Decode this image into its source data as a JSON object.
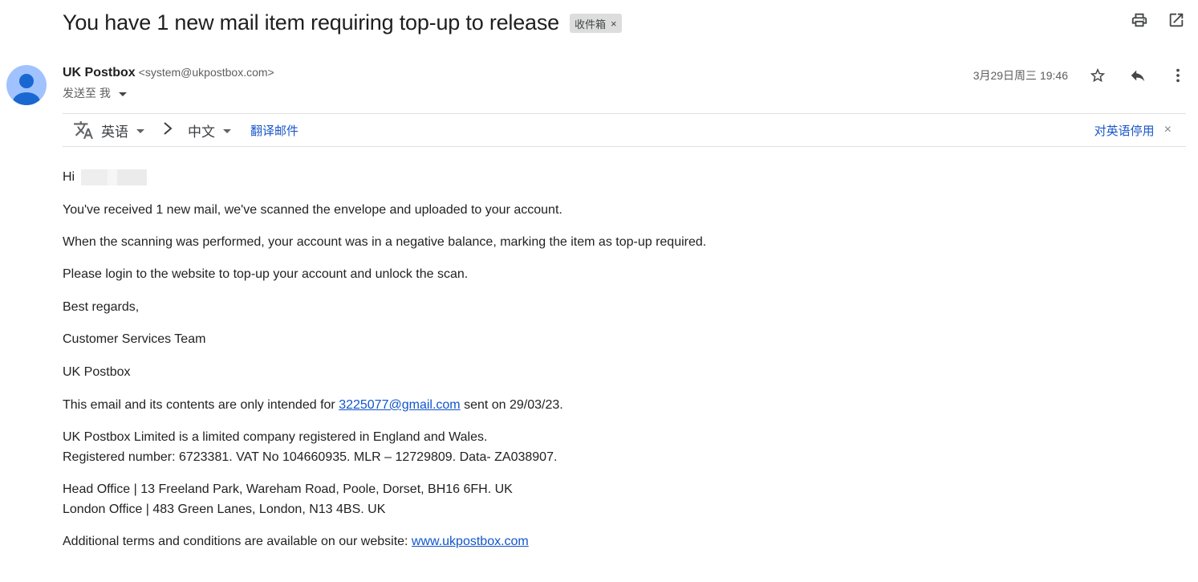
{
  "subject": "You have 1 new mail item requiring top-up to release",
  "label": {
    "text": "收件箱",
    "remove": "×"
  },
  "icons": {
    "print": "print-icon",
    "popout": "open-in-new-icon",
    "star": "star-icon",
    "reply": "reply-icon",
    "more": "more-vert-icon",
    "translate": "translate-icon",
    "arrow": "chevron-right-icon"
  },
  "sender": {
    "name": "UK Postbox",
    "email": "<system@ukpostbox.com>",
    "to_label": "发送至 我"
  },
  "date": "3月29日周三 19:46",
  "translate_bar": {
    "from_lang": "英语",
    "to_lang": "中文",
    "translate_link": "翻译邮件",
    "disable_link": "对英语停用",
    "close": "×"
  },
  "body": {
    "greeting": "Hi",
    "p1": "You've received 1 new mail, we've scanned the envelope and uploaded to your account.",
    "p2": "When the scanning was performed, your account was in a negative balance, marking the item as top-up required.",
    "p3": "Please login to the website to top-up your account and unlock the scan.",
    "regards": "Best regards,",
    "team": "Customer Services Team",
    "company": "UK Postbox",
    "intended_pre": "This email and its contents are only intended for ",
    "intended_email": "3225077@gmail.com",
    "intended_post": " sent on 29/03/23.",
    "reg_line1": "UK Postbox Limited is a limited company registered in England and Wales.",
    "reg_line2": "Registered number: 6723381. VAT No 104660935. MLR – 12729809. Data- ZA038907.",
    "office1": "Head Office | 13 Freeland Park, Wareham Road, Poole, Dorset, BH16 6FH. UK",
    "office2": "London Office | 483 Green Lanes, London, N13 4BS. UK",
    "terms_pre": "Additional terms and conditions are available on our website: ",
    "terms_link": "www.ukpostbox.com"
  },
  "colors": {
    "link": "#1155cc",
    "accent_link": "#1a57c9",
    "avatar_bg": "#a0c3ff",
    "avatar_fg": "#1a67d2"
  }
}
